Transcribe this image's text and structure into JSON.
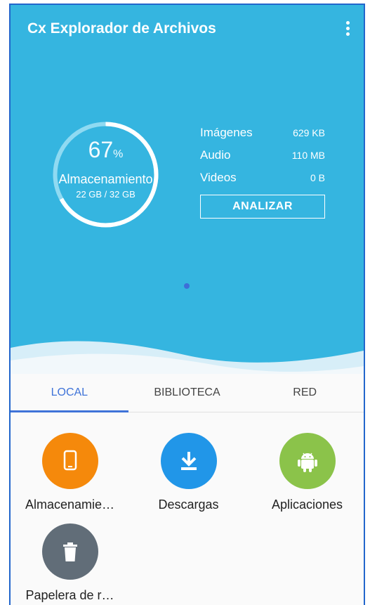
{
  "app": {
    "title": "Cx Explorador de Archivos"
  },
  "storage": {
    "percent": "67",
    "percent_sign": "%",
    "percent_value": 0.67,
    "label": "Almacenamiento",
    "size": "22 GB / 32 GB"
  },
  "stats": [
    {
      "name": "Imágenes",
      "value": "629 KB"
    },
    {
      "name": "Audio",
      "value": "110 MB"
    },
    {
      "name": "Videos",
      "value": "0 B"
    }
  ],
  "analyze_label": "ANALIZAR",
  "tabs": [
    {
      "label": "LOCAL"
    },
    {
      "label": "BIBLIOTECA"
    },
    {
      "label": "RED"
    }
  ],
  "items": [
    {
      "label": "Almacenamie…",
      "color": "#f5890b",
      "icon": "phone-icon"
    },
    {
      "label": "Descargas",
      "color": "#2196e8",
      "icon": "download-icon"
    },
    {
      "label": "Aplicaciones",
      "color": "#8bc34a",
      "icon": "android-icon"
    },
    {
      "label": "Papelera de r…",
      "color": "#616d78",
      "icon": "trash-icon"
    }
  ],
  "colors": {
    "header_bg": "#35b5e0",
    "accent": "#3f73d8"
  }
}
